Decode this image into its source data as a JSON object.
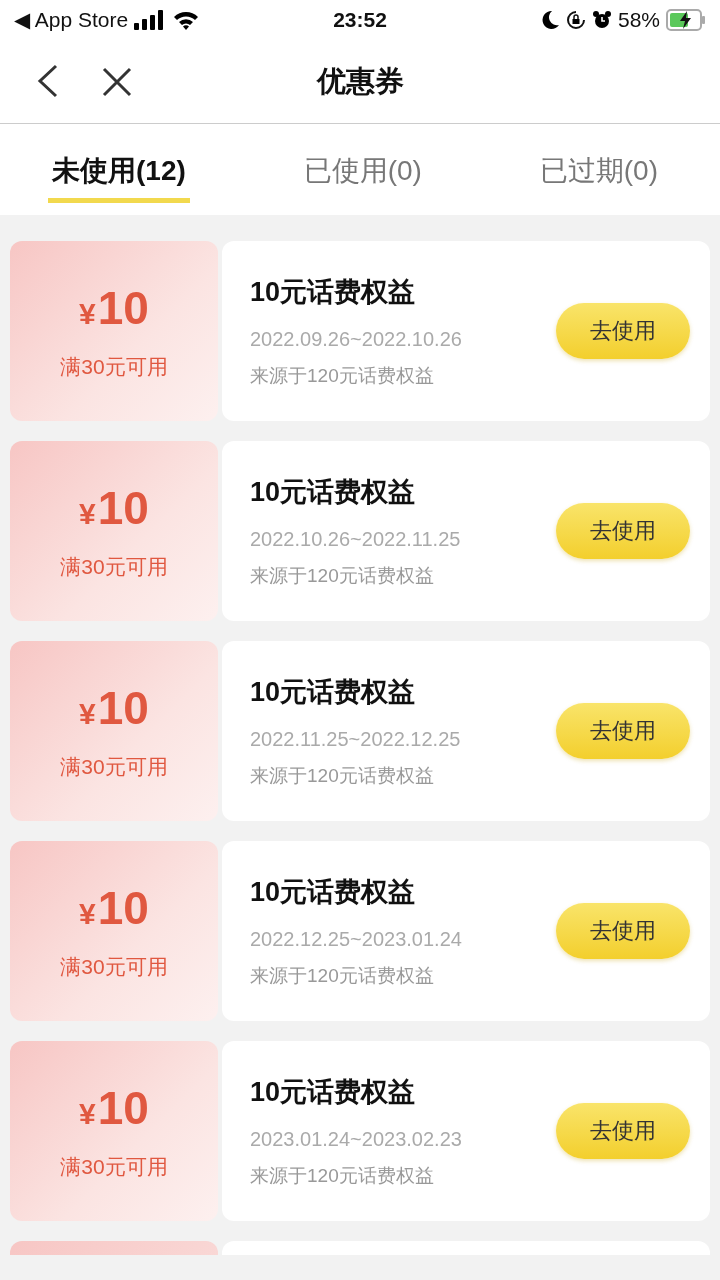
{
  "status_bar": {
    "back_label": "◀ App Store",
    "time": "23:52",
    "battery": "58%"
  },
  "nav": {
    "title": "优惠券"
  },
  "tabs": [
    {
      "label": "未使用(12)",
      "selected": true
    },
    {
      "label": "已使用(0)",
      "selected": false
    },
    {
      "label": "已过期(0)",
      "selected": false
    }
  ],
  "coupons": [
    {
      "currency": "¥",
      "amount": "10",
      "condition": "满30元可用",
      "title": "10元话费权益",
      "validity": "2022.09.26~2022.10.26",
      "source": "来源于120元话费权益",
      "button": "去使用"
    },
    {
      "currency": "¥",
      "amount": "10",
      "condition": "满30元可用",
      "title": "10元话费权益",
      "validity": "2022.10.26~2022.11.25",
      "source": "来源于120元话费权益",
      "button": "去使用"
    },
    {
      "currency": "¥",
      "amount": "10",
      "condition": "满30元可用",
      "title": "10元话费权益",
      "validity": "2022.11.25~2022.12.25",
      "source": "来源于120元话费权益",
      "button": "去使用"
    },
    {
      "currency": "¥",
      "amount": "10",
      "condition": "满30元可用",
      "title": "10元话费权益",
      "validity": "2022.12.25~2023.01.24",
      "source": "来源于120元话费权益",
      "button": "去使用"
    },
    {
      "currency": "¥",
      "amount": "10",
      "condition": "满30元可用",
      "title": "10元话费权益",
      "validity": "2023.01.24~2023.02.23",
      "source": "来源于120元话费权益",
      "button": "去使用"
    }
  ]
}
